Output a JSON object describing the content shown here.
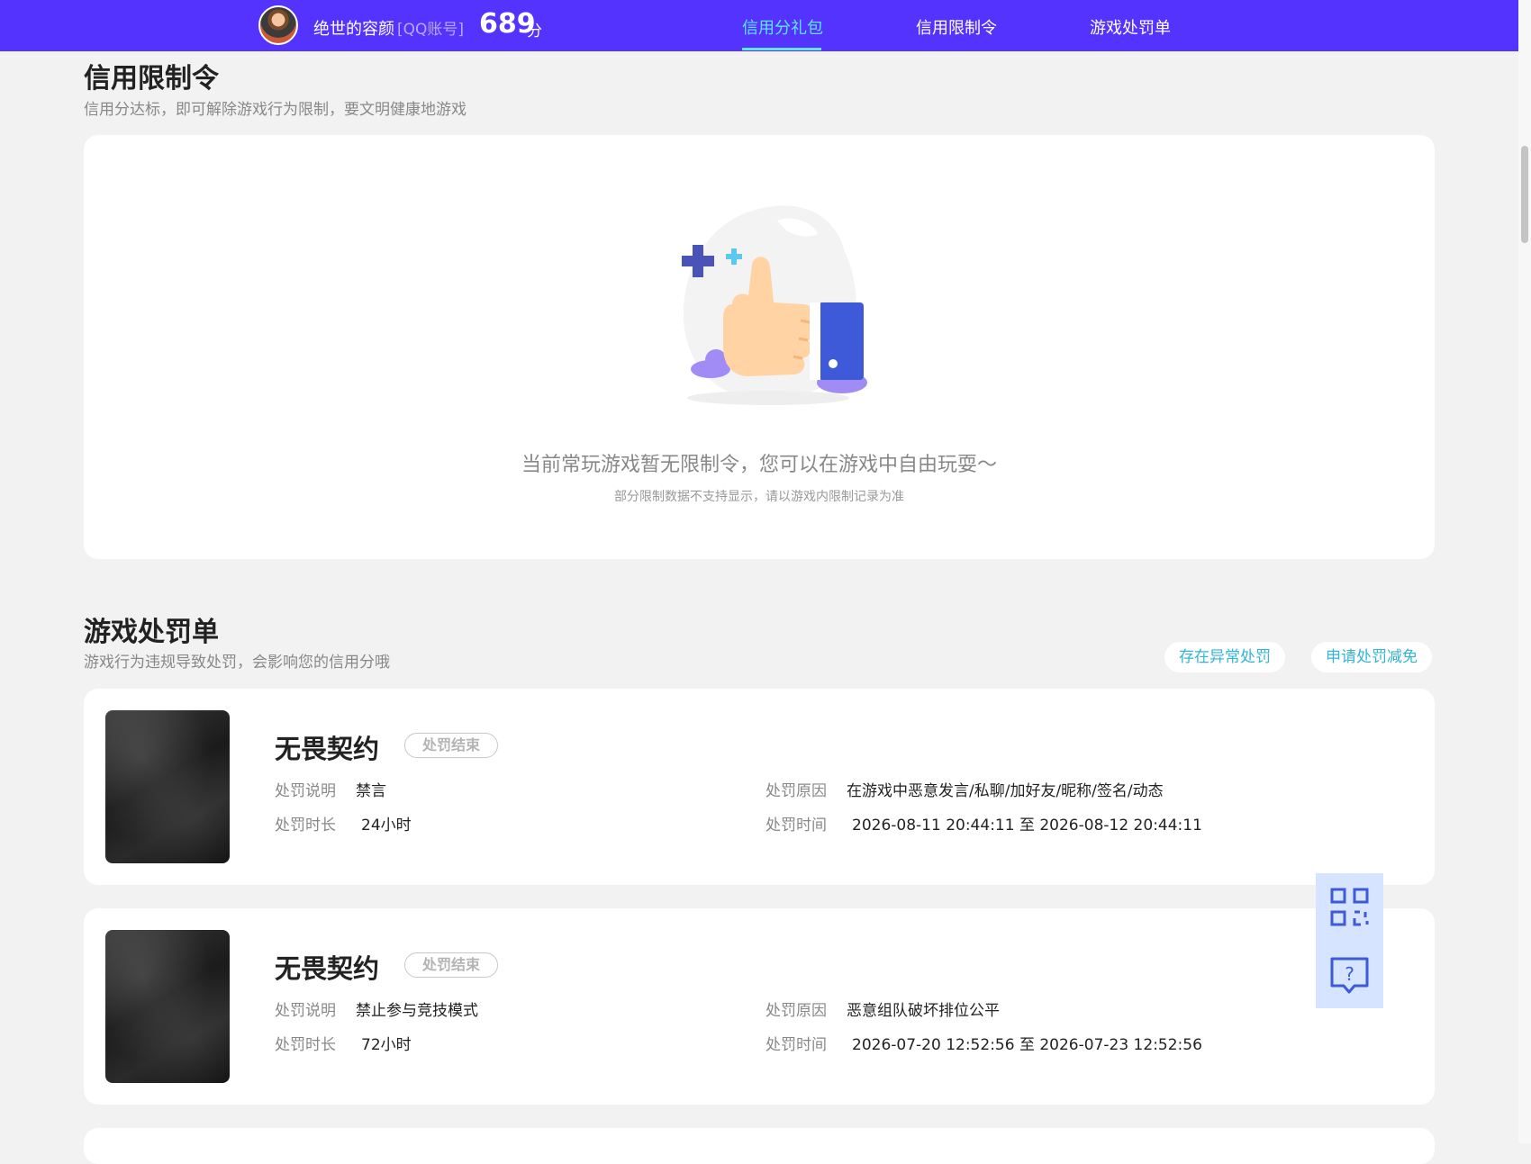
{
  "header": {
    "user_name": "绝世的容颜",
    "account_type": "[QQ账号]",
    "score": "689",
    "score_unit": "分",
    "tabs": [
      {
        "label": "信用分礼包",
        "active": true
      },
      {
        "label": "信用限制令",
        "active": false
      },
      {
        "label": "游戏处罚单",
        "active": false
      }
    ]
  },
  "restrictions": {
    "title": "信用限制令",
    "subtitle": "信用分达标，即可解除游戏行为限制，要文明健康地游戏",
    "empty_message": "当前常玩游戏暂无限制令，您可以在游戏中自由玩耍～",
    "empty_note": "部分限制数据不支持显示，请以游戏内限制记录为准"
  },
  "penalties": {
    "title": "游戏处罚单",
    "subtitle": "游戏行为违规导致处罚，会影响您的信用分哦",
    "report_button": "存在异常处罚",
    "appeal_button": "申请处罚减免",
    "labels": {
      "description": "处罚说明",
      "duration": "处罚时长",
      "reason": "处罚原因",
      "time": "处罚时间"
    },
    "items": [
      {
        "game": "无畏契约",
        "status": "处罚结束",
        "description": "禁言",
        "duration": "24小时",
        "reason": "在游戏中恶意发言/私聊/加好友/昵称/签名/动态",
        "time": "2026-08-11 20:44:11 至 2026-08-12 20:44:11"
      },
      {
        "game": "无畏契约",
        "status": "处罚结束",
        "description": "禁止参与竞技模式",
        "duration": "72小时",
        "reason": "恶意组队破坏排位公平",
        "time": "2026-07-20 12:52:56 至 2026-07-23 12:52:56"
      }
    ]
  },
  "floating": {
    "icons": [
      "qr-code-icon",
      "help-chat-icon"
    ]
  },
  "colors": {
    "header_bg": "#5533ff",
    "tab_active": "#5ee6ff",
    "link": "#33b5d8",
    "page_bg": "#f2f2f2"
  }
}
